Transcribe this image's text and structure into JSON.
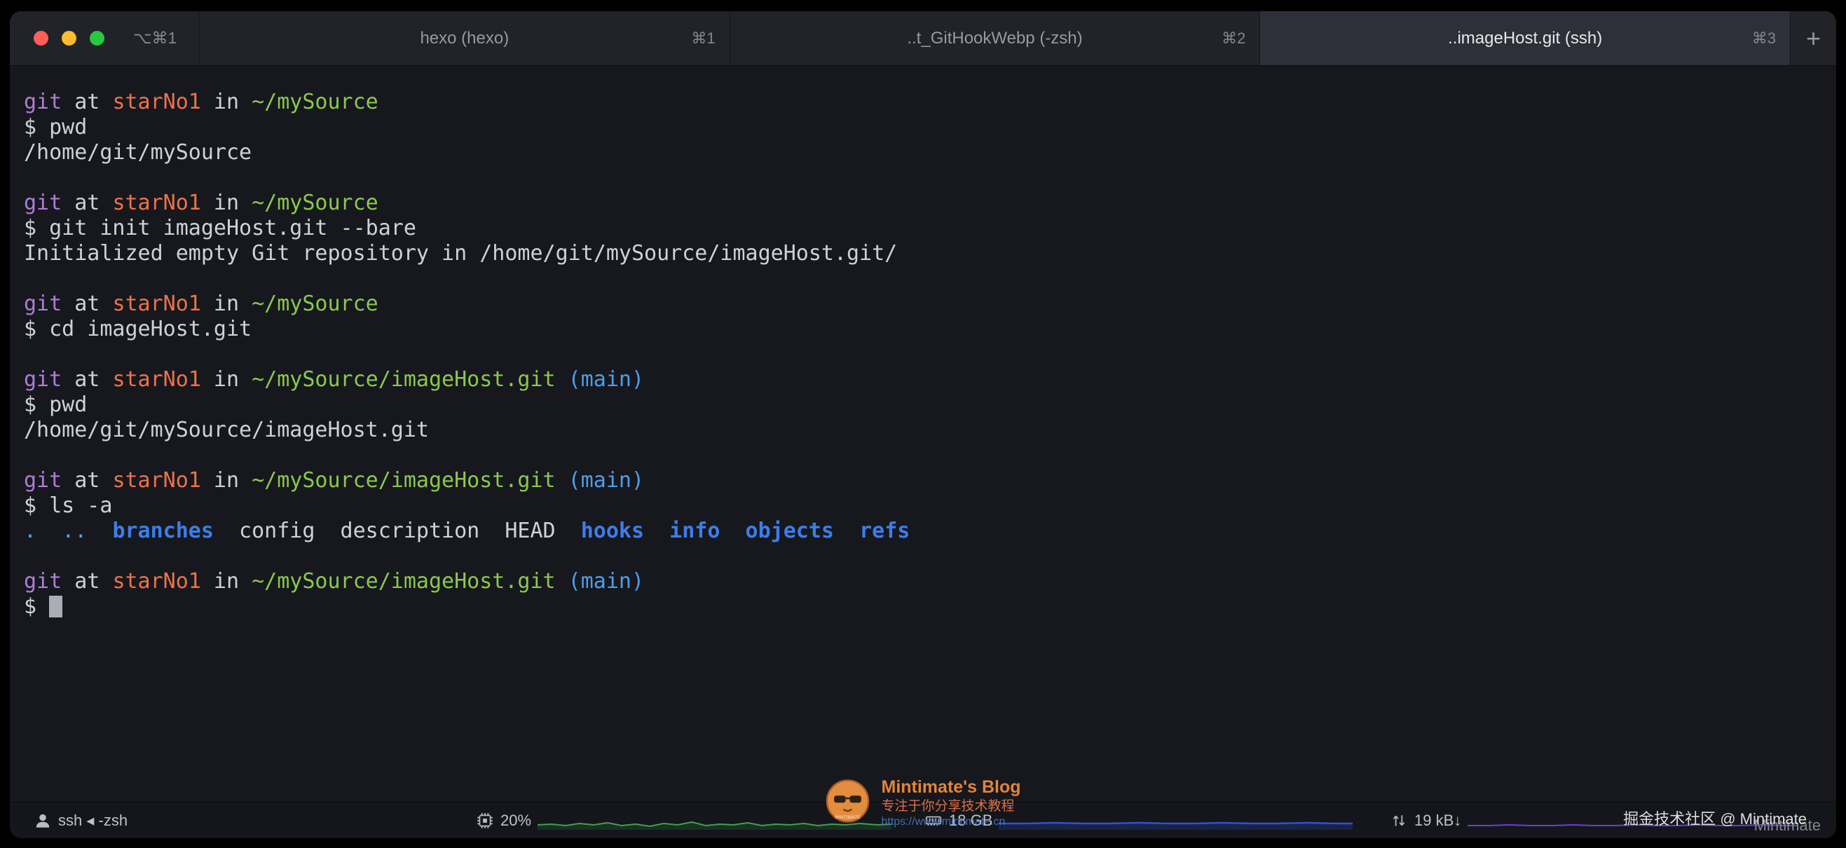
{
  "window": {
    "window_shortcut": "⌥⌘1",
    "new_tab_label": "+",
    "tabs": [
      {
        "label": "hexo (hexo)",
        "shortcut": "⌘1",
        "active": false
      },
      {
        "label": "..t_GitHookWebp (-zsh)",
        "shortcut": "⌘2",
        "active": false
      },
      {
        "label": "..imageHost.git (ssh)",
        "shortcut": "⌘3",
        "active": true
      }
    ]
  },
  "terminal": {
    "lines": [
      {
        "segments": [
          {
            "t": "git",
            "c": "magenta"
          },
          {
            "t": " at ",
            "c": "fg"
          },
          {
            "t": "starNo1",
            "c": "orange"
          },
          {
            "t": " in ",
            "c": "fg"
          },
          {
            "t": "~/mySource",
            "c": "green"
          }
        ]
      },
      {
        "segments": [
          {
            "t": "$ pwd",
            "c": "fg"
          }
        ]
      },
      {
        "segments": [
          {
            "t": "/home/git/mySource",
            "c": "fg"
          }
        ]
      },
      {
        "segments": []
      },
      {
        "segments": [
          {
            "t": "git",
            "c": "magenta"
          },
          {
            "t": " at ",
            "c": "fg"
          },
          {
            "t": "starNo1",
            "c": "orange"
          },
          {
            "t": " in ",
            "c": "fg"
          },
          {
            "t": "~/mySource",
            "c": "green"
          }
        ]
      },
      {
        "segments": [
          {
            "t": "$ git init imageHost.git --bare",
            "c": "fg"
          }
        ]
      },
      {
        "segments": [
          {
            "t": "Initialized empty Git repository in /home/git/mySource/imageHost.git/",
            "c": "fg"
          }
        ]
      },
      {
        "segments": []
      },
      {
        "segments": [
          {
            "t": "git",
            "c": "magenta"
          },
          {
            "t": " at ",
            "c": "fg"
          },
          {
            "t": "starNo1",
            "c": "orange"
          },
          {
            "t": " in ",
            "c": "fg"
          },
          {
            "t": "~/mySource",
            "c": "green"
          }
        ]
      },
      {
        "segments": [
          {
            "t": "$ cd imageHost.git",
            "c": "fg"
          }
        ]
      },
      {
        "segments": []
      },
      {
        "segments": [
          {
            "t": "git",
            "c": "magenta"
          },
          {
            "t": " at ",
            "c": "fg"
          },
          {
            "t": "starNo1",
            "c": "orange"
          },
          {
            "t": " in ",
            "c": "fg"
          },
          {
            "t": "~/mySource/imageHost.git",
            "c": "green"
          },
          {
            "t": " ",
            "c": "fg"
          },
          {
            "t": "(main)",
            "c": "blue"
          }
        ]
      },
      {
        "segments": [
          {
            "t": "$ pwd",
            "c": "fg"
          }
        ]
      },
      {
        "segments": [
          {
            "t": "/home/git/mySource/imageHost.git",
            "c": "fg"
          }
        ]
      },
      {
        "segments": []
      },
      {
        "segments": [
          {
            "t": "git",
            "c": "magenta"
          },
          {
            "t": " at ",
            "c": "fg"
          },
          {
            "t": "starNo1",
            "c": "orange"
          },
          {
            "t": " in ",
            "c": "fg"
          },
          {
            "t": "~/mySource/imageHost.git",
            "c": "green"
          },
          {
            "t": " ",
            "c": "fg"
          },
          {
            "t": "(main)",
            "c": "blue"
          }
        ]
      },
      {
        "segments": [
          {
            "t": "$ ls -a",
            "c": "fg"
          }
        ]
      },
      {
        "segments": [
          {
            "t": ".",
            "c": "blue"
          },
          {
            "t": "  ",
            "c": "fg"
          },
          {
            "t": "..",
            "c": "blue"
          },
          {
            "t": "  ",
            "c": "fg"
          },
          {
            "t": "branches",
            "c": "bluebold"
          },
          {
            "t": "  config  description  HEAD  ",
            "c": "fg"
          },
          {
            "t": "hooks",
            "c": "bluebold"
          },
          {
            "t": "  ",
            "c": "fg"
          },
          {
            "t": "info",
            "c": "bluebold"
          },
          {
            "t": "  ",
            "c": "fg"
          },
          {
            "t": "objects",
            "c": "bluebold"
          },
          {
            "t": "  ",
            "c": "fg"
          },
          {
            "t": "refs",
            "c": "bluebold"
          }
        ]
      },
      {
        "segments": []
      },
      {
        "segments": [
          {
            "t": "git",
            "c": "magenta"
          },
          {
            "t": " at ",
            "c": "fg"
          },
          {
            "t": "starNo1",
            "c": "orange"
          },
          {
            "t": " in ",
            "c": "fg"
          },
          {
            "t": "~/mySource/imageHost.git",
            "c": "green"
          },
          {
            "t": " ",
            "c": "fg"
          },
          {
            "t": "(main)",
            "c": "blue"
          }
        ]
      },
      {
        "segments": [
          {
            "t": "$ ",
            "c": "fg"
          }
        ],
        "cursor": true
      }
    ]
  },
  "status_bar": {
    "shell": "ssh ◂ -zsh",
    "cpu": "20%",
    "memory": "18 GB",
    "network": "19 kB↓",
    "host_text": "Mintimate",
    "right_text": "掘金技术社区 @ Mintimate",
    "icons": [
      "user-icon",
      "cpu-icon",
      "memory-icon",
      "network-icon"
    ]
  },
  "watermark": {
    "title": "Mintimate's Blog",
    "subtitle": "专注于你分享技术教程",
    "url": "https://www.mintimate.cn"
  },
  "colors": {
    "term-bg": "#16181e",
    "term-fg": "#ced2d6",
    "term-magenta": "#af7dd4",
    "term-orange": "#ed7249",
    "term-green": "#8cc84b",
    "term-blue": "#4f9de8",
    "term-dir-blue": "#3d7de9",
    "cursor": "#a9aeb6",
    "cpu-graph": "#3da14f",
    "mem-graph": "#3050d8",
    "net-graph": "#6a3ae0",
    "watermark-orange": "#ed8a3c",
    "watermark-red": "#e4744f",
    "watermark-link": "#4e7ecb"
  }
}
